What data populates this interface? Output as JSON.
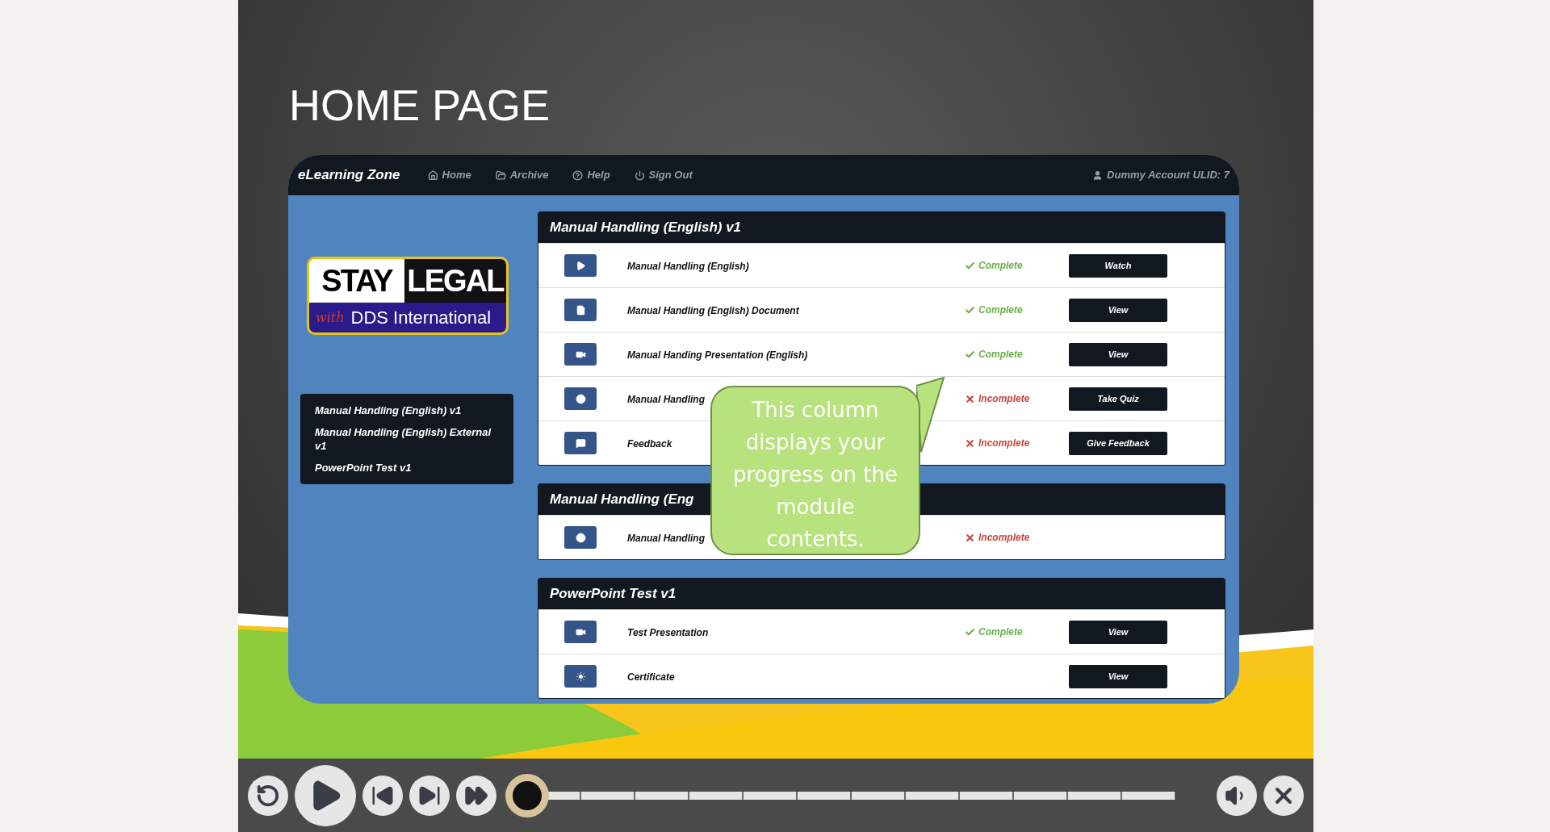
{
  "slide_title": "HOME PAGE",
  "navbar": {
    "brand": "eLearning Zone",
    "links": [
      {
        "label": "Home",
        "kind": "home"
      },
      {
        "label": "Archive",
        "kind": "archive"
      },
      {
        "label": "Help",
        "kind": "help"
      },
      {
        "label": "Sign Out",
        "kind": "signout"
      }
    ],
    "account": "Dummy Account ULID: 7"
  },
  "logo": {
    "word_1": "STAY",
    "word_2": "LEGAL",
    "script": "with",
    "company": "DDS International"
  },
  "sidebar": {
    "items": [
      "Manual Handling (English) v1",
      "Manual Handling (English) External v1",
      "PowerPoint Test v1"
    ]
  },
  "modules": [
    {
      "title": "Manual Handling (English) v1",
      "rows": [
        {
          "kind": "play",
          "name": "Manual Handling (English)",
          "status": "Complete",
          "complete": true,
          "action": "Watch"
        },
        {
          "kind": "document",
          "name": "Manual Handling (English) Document",
          "status": "Complete",
          "complete": true,
          "action": "View"
        },
        {
          "kind": "video",
          "name": "Manual Handing Presentation (English)",
          "status": "Complete",
          "complete": true,
          "action": "View"
        },
        {
          "kind": "quiz",
          "name": "Manual Handling",
          "status": "Incomplete",
          "complete": false,
          "action": "Take Quiz"
        },
        {
          "kind": "feedback",
          "name": "Feedback",
          "status": "Incomplete",
          "complete": false,
          "action": "Give Feedback"
        }
      ]
    },
    {
      "title": "Manual Handling (Eng",
      "rows": [
        {
          "kind": "external",
          "name": "Manual Handling",
          "status": "Incomplete",
          "complete": false
        }
      ]
    },
    {
      "title": "PowerPoint Test v1",
      "rows": [
        {
          "kind": "video",
          "name": "Test Presentation",
          "status": "Complete",
          "complete": true,
          "action": "View"
        },
        {
          "kind": "certificate",
          "name": "Certificate",
          "action": "View"
        }
      ]
    }
  ],
  "callout": {
    "text": "This column displays your progress on the module contents."
  },
  "player": {
    "seekbar": {
      "level": 0
    }
  }
}
